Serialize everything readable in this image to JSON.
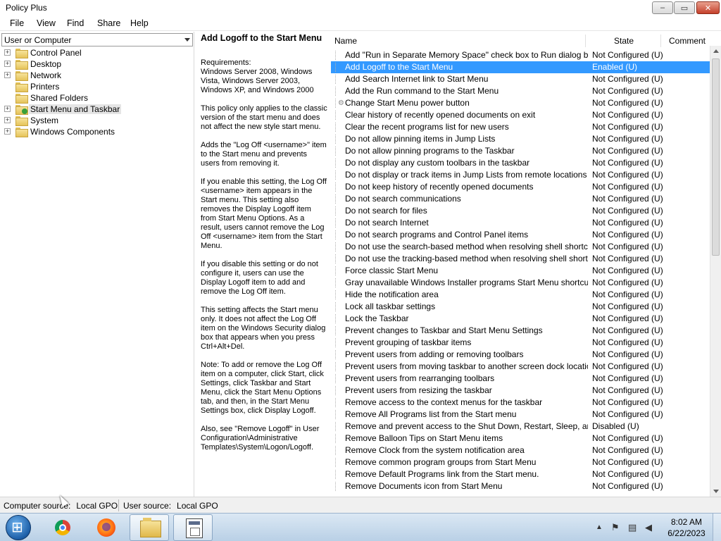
{
  "window": {
    "title": "Policy Plus",
    "controls": {
      "minimize": "–",
      "maximize": "▭",
      "close": "✕"
    }
  },
  "menu": [
    "File",
    "View",
    "Find",
    "Share",
    "Help"
  ],
  "left": {
    "scope": "User or Computer",
    "tree": [
      {
        "label": "Control Panel",
        "expandable": true
      },
      {
        "label": "Desktop",
        "expandable": true
      },
      {
        "label": "Network",
        "expandable": true
      },
      {
        "label": "Printers",
        "expandable": false
      },
      {
        "label": "Shared Folders",
        "expandable": false
      },
      {
        "label": "Start Menu and Taskbar",
        "expandable": true,
        "selected": true
      },
      {
        "label": "System",
        "expandable": true
      },
      {
        "label": "Windows Components",
        "expandable": true
      }
    ]
  },
  "detail": {
    "title": "Add Logoff to the Start Menu",
    "paragraphs": [
      "Requirements:\nWindows Server 2008, Windows Vista, Windows Server 2003, Windows XP, and Windows 2000",
      "This policy only applies to the classic version of the start menu and does not affect the new style start menu.",
      "Adds the \"Log Off <username>\" item to the Start menu and prevents users from removing it.",
      "If you enable this setting, the Log Off <username> item appears in the Start menu. This setting also removes the Display Logoff item from Start Menu Options. As a result, users cannot remove the Log Off <username> item from the Start Menu.",
      "If you disable this setting or do not configure it, users can use the Display Logoff item to add and remove the Log Off item.",
      "This setting affects the Start menu only. It does not affect the Log Off item on the Windows Security dialog box that appears when you press Ctrl+Alt+Del.",
      "Note: To add or remove the Log Off item on a computer, click Start, click Settings, click Taskbar and Start Menu, click the Start Menu Options tab, and then, in the Start Menu Settings box, click Display Logoff.",
      "Also, see \"Remove Logoff\" in User Configuration\\Administrative Templates\\System\\Logon/Logoff."
    ]
  },
  "list": {
    "columns": [
      "Name",
      "State",
      "Comment"
    ],
    "rows": [
      {
        "name": "Add \"Run in Separate Memory Space\" check box to Run dialog box",
        "state": "Not Configured (U)"
      },
      {
        "name": "Add Logoff to the Start Menu",
        "state": "Enabled (U)",
        "selected": true
      },
      {
        "name": "Add Search Internet link to Start Menu",
        "state": "Not Configured (U)"
      },
      {
        "name": "Add the Run command to the Start Menu",
        "state": "Not Configured (U)"
      },
      {
        "name": "Change Start Menu power button",
        "state": "Not Configured (U)",
        "gear": true
      },
      {
        "name": "Clear history of recently opened documents on exit",
        "state": "Not Configured (U)"
      },
      {
        "name": "Clear the recent programs list for new users",
        "state": "Not Configured (U)"
      },
      {
        "name": "Do not allow pinning items in Jump Lists",
        "state": "Not Configured (U)"
      },
      {
        "name": "Do not allow pinning programs to the Taskbar",
        "state": "Not Configured (U)"
      },
      {
        "name": "Do not display any custom toolbars in the taskbar",
        "state": "Not Configured (U)"
      },
      {
        "name": "Do not display or track items in Jump Lists from remote locations",
        "state": "Not Configured (U)"
      },
      {
        "name": "Do not keep history of recently opened documents",
        "state": "Not Configured (U)"
      },
      {
        "name": "Do not search communications",
        "state": "Not Configured (U)"
      },
      {
        "name": "Do not search for files",
        "state": "Not Configured (U)"
      },
      {
        "name": "Do not search Internet",
        "state": "Not Configured (U)"
      },
      {
        "name": "Do not search programs and Control Panel items",
        "state": "Not Configured (U)"
      },
      {
        "name": "Do not use the search-based method when resolving shell shortcuts",
        "state": "Not Configured (U)"
      },
      {
        "name": "Do not use the tracking-based method when resolving shell shortcuts",
        "state": "Not Configured (U)"
      },
      {
        "name": "Force classic Start Menu",
        "state": "Not Configured (U)"
      },
      {
        "name": "Gray unavailable Windows Installer programs Start Menu shortcuts",
        "state": "Not Configured (U)"
      },
      {
        "name": "Hide the notification area",
        "state": "Not Configured (U)"
      },
      {
        "name": "Lock all taskbar settings",
        "state": "Not Configured (U)"
      },
      {
        "name": "Lock the Taskbar",
        "state": "Not Configured (U)"
      },
      {
        "name": "Prevent changes to Taskbar and Start Menu Settings",
        "state": "Not Configured (U)"
      },
      {
        "name": "Prevent grouping of taskbar items",
        "state": "Not Configured (U)"
      },
      {
        "name": "Prevent users from adding or removing toolbars",
        "state": "Not Configured (U)"
      },
      {
        "name": "Prevent users from moving taskbar to another screen dock location",
        "state": "Not Configured (U)"
      },
      {
        "name": "Prevent users from rearranging toolbars",
        "state": "Not Configured (U)"
      },
      {
        "name": "Prevent users from resizing the taskbar",
        "state": "Not Configured (U)"
      },
      {
        "name": "Remove access to the context menus for the taskbar",
        "state": "Not Configured (U)"
      },
      {
        "name": "Remove All Programs list from the Start menu",
        "state": "Not Configured (U)"
      },
      {
        "name": "Remove and prevent access to the Shut Down, Restart, Sleep, and ...",
        "state": "Disabled (U)"
      },
      {
        "name": "Remove Balloon Tips on Start Menu items",
        "state": "Not Configured (U)"
      },
      {
        "name": "Remove Clock from the system notification area",
        "state": "Not Configured (U)"
      },
      {
        "name": "Remove common program groups from Start Menu",
        "state": "Not Configured (U)"
      },
      {
        "name": "Remove Default Programs link from the Start menu.",
        "state": "Not Configured (U)"
      },
      {
        "name": "Remove Documents icon from Start Menu",
        "state": "Not Configured (U)"
      }
    ]
  },
  "status": {
    "computer_label": "Computer source:",
    "computer_value": "Local GPO",
    "user_label": "User source:",
    "user_value": "Local GPO"
  },
  "taskbar": {
    "apps": [
      "chrome-icon",
      "firefox-icon",
      "file-explorer-icon",
      "policy-plus-icon"
    ],
    "tray_icons": [
      "show-hidden-icons-icon",
      "action-center-icon",
      "network-icon",
      "volume-muted-icon"
    ],
    "time": "8:02 AM",
    "date": "6/22/2023"
  }
}
